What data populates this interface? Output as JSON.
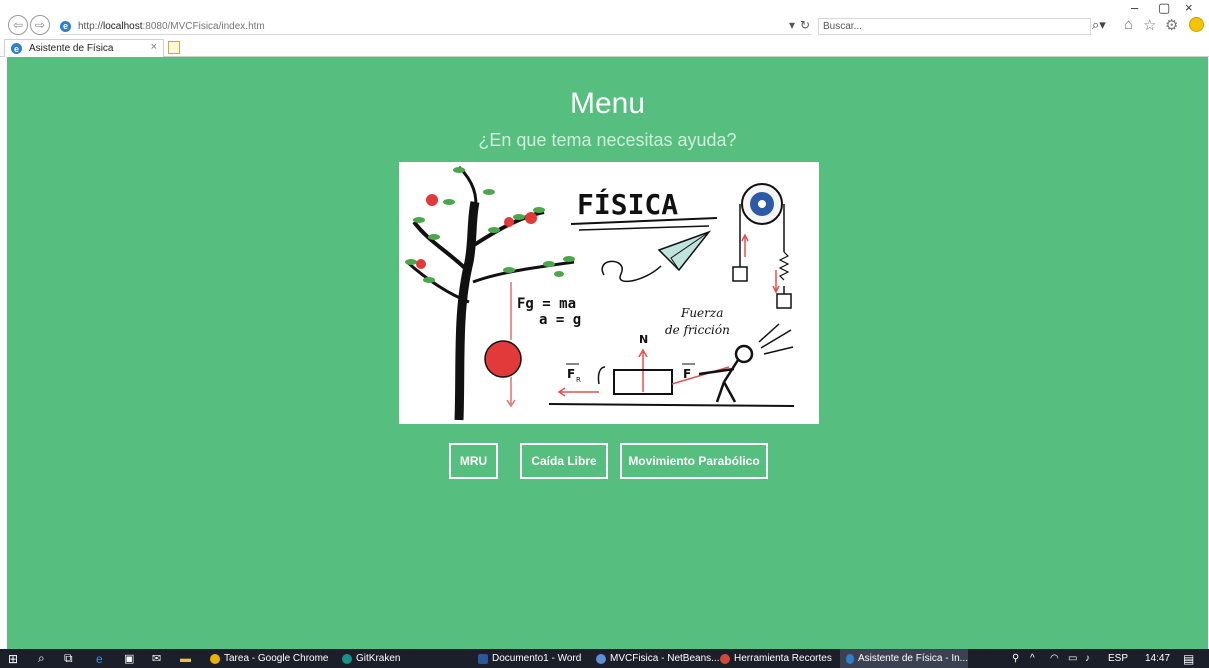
{
  "browser": {
    "address": {
      "scheme": "http://",
      "host": "localhost",
      "path": ":8080/MVCFisica/index.htm"
    },
    "search_placeholder": "Buscar...",
    "tab_title": "Asistente de Física",
    "tab_close": "×",
    "address_dropdown": "▾",
    "refresh_icon": "↻",
    "search_dropdown": "⌕▾",
    "window_controls": {
      "minimize": "–",
      "restore": "▢",
      "close": "×"
    }
  },
  "page": {
    "title": "Menu",
    "subtitle": "¿En que tema necesitas ayuda?",
    "image": {
      "title_text": "FÍSICA",
      "formula_1": "Fg = ma",
      "formula_2": "a = g",
      "friction_1": "Fuerza",
      "friction_2": "de fricción",
      "normal": "N",
      "force_r": "F",
      "force_r_sub": "R",
      "force": "F"
    },
    "buttons": [
      {
        "label": "MRU"
      },
      {
        "label": "Caída Libre"
      },
      {
        "label": "Movimiento Parabólico"
      }
    ]
  },
  "taskbar": {
    "items": [
      {
        "label": "Tarea - Google Chrome",
        "color": "#e8b400"
      },
      {
        "label": "GitKraken",
        "color": "#179287"
      },
      {
        "label": "Documento1 - Word",
        "color": "#2b579a"
      },
      {
        "label": "MVCFisica - NetBeans...",
        "color": "#5b8fd6"
      },
      {
        "label": "Herramienta Recortes",
        "color": "#d04a3a"
      },
      {
        "label": "Asistente de Física - In...",
        "color": "#2d7fd0"
      }
    ],
    "tray": {
      "language": "ESP",
      "time": "14:47"
    }
  },
  "colors": {
    "page_background": "#56be7e",
    "button_border": "#ffffff",
    "taskbar": "#1b1f2a"
  }
}
